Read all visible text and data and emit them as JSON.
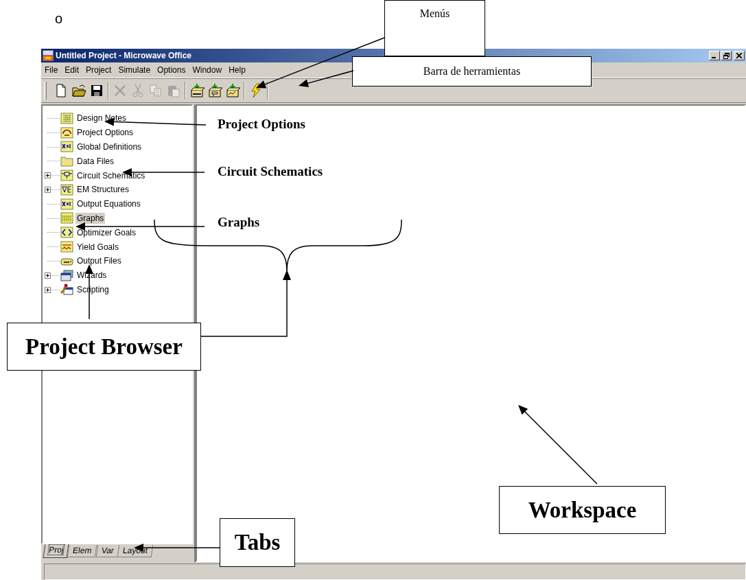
{
  "bullet": "o",
  "window": {
    "title": "Untitled Project - Microwave Office"
  },
  "menu": [
    "File",
    "Edit",
    "Project",
    "Simulate",
    "Options",
    "Window",
    "Help"
  ],
  "toolbar": [
    {
      "disabled": false
    },
    {
      "disabled": false
    },
    {
      "disabled": false
    },
    {
      "disabled": true
    },
    {
      "disabled": true
    },
    {
      "disabled": true
    },
    {
      "disabled": true
    },
    {
      "disabled": false
    },
    {
      "disabled": false
    },
    {
      "disabled": false
    },
    {
      "disabled": false
    }
  ],
  "tree": [
    {
      "label": "Design Notes",
      "kind": "leaf",
      "selected": false
    },
    {
      "label": "Project Options",
      "kind": "leaf",
      "selected": false
    },
    {
      "label": "Global Definitions",
      "kind": "leaf",
      "selected": false
    },
    {
      "label": "Data Files",
      "kind": "leaf",
      "selected": false
    },
    {
      "label": "Circuit Schematics",
      "kind": "group",
      "selected": false
    },
    {
      "label": "EM Structures",
      "kind": "group",
      "selected": false
    },
    {
      "label": "Output Equations",
      "kind": "leaf",
      "selected": false
    },
    {
      "label": "Graphs",
      "kind": "leaf",
      "selected": true
    },
    {
      "label": "Optimizer Goals",
      "kind": "leaf",
      "selected": false
    },
    {
      "label": "Yield Goals",
      "kind": "leaf",
      "selected": false
    },
    {
      "label": "Output Files",
      "kind": "leaf",
      "selected": false
    },
    {
      "label": "Wizards",
      "kind": "group",
      "selected": false
    },
    {
      "label": "Scripting",
      "kind": "group",
      "selected": false
    }
  ],
  "tabs": [
    {
      "label": "Proj",
      "selected": true
    },
    {
      "label": "Elem",
      "selected": false
    },
    {
      "label": "Var",
      "selected": false
    },
    {
      "label": "Layout",
      "selected": false
    }
  ],
  "annotations": [
    {
      "kind": "box",
      "text": "Menús"
    },
    {
      "kind": "box",
      "text": "Barra de herramientas"
    },
    {
      "kind": "label",
      "text": "Project Options"
    },
    {
      "kind": "label",
      "text": "Circuit Schematics"
    },
    {
      "kind": "label",
      "text": "Graphs"
    },
    {
      "kind": "big-box",
      "text": "Project Browser"
    },
    {
      "kind": "big-box",
      "text": "Workspace"
    },
    {
      "kind": "big-box",
      "text": "Tabs"
    }
  ]
}
